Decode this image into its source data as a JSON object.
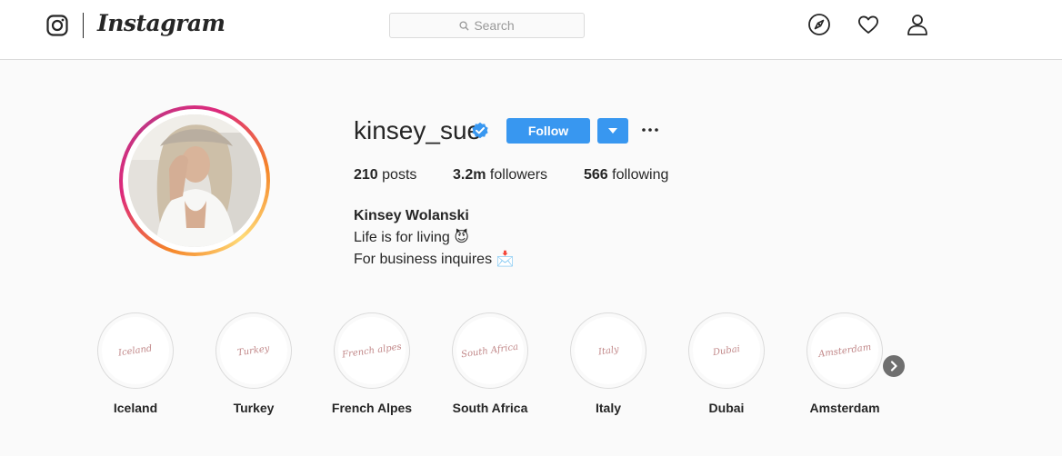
{
  "nav": {
    "wordmark": "Instagram",
    "search_placeholder": "Search",
    "icons": [
      "instagram-logo-icon",
      "compass-icon",
      "heart-icon",
      "profile-icon"
    ]
  },
  "profile": {
    "username": "kinsey_sue",
    "verified": true,
    "follow_label": "Follow",
    "stats": {
      "posts_count": "210",
      "posts_label": " posts",
      "followers_count": "3.2m",
      "followers_label": " followers",
      "following_count": "566",
      "following_label": " following"
    },
    "bio": {
      "name": "Kinsey Wolanski",
      "line1": "Life is for living 😈",
      "line2": "For business inquires 📩"
    }
  },
  "highlights": [
    {
      "label": "Iceland",
      "cover_text": "Iceland"
    },
    {
      "label": "Turkey",
      "cover_text": "Turkey"
    },
    {
      "label": "French Alpes",
      "cover_text": "French alpes"
    },
    {
      "label": "South Africa",
      "cover_text": "South Africa"
    },
    {
      "label": "Italy",
      "cover_text": "Italy"
    },
    {
      "label": "Dubai",
      "cover_text": "Dubai"
    },
    {
      "label": "Amsterdam",
      "cover_text": "Amsterdam"
    }
  ],
  "colors": {
    "accent": "#3897f0",
    "text": "#262626",
    "background": "#fafafa",
    "border": "#dbdbdb",
    "story_ring": [
      "#f58529",
      "#dd2a7b",
      "#c13584"
    ]
  }
}
